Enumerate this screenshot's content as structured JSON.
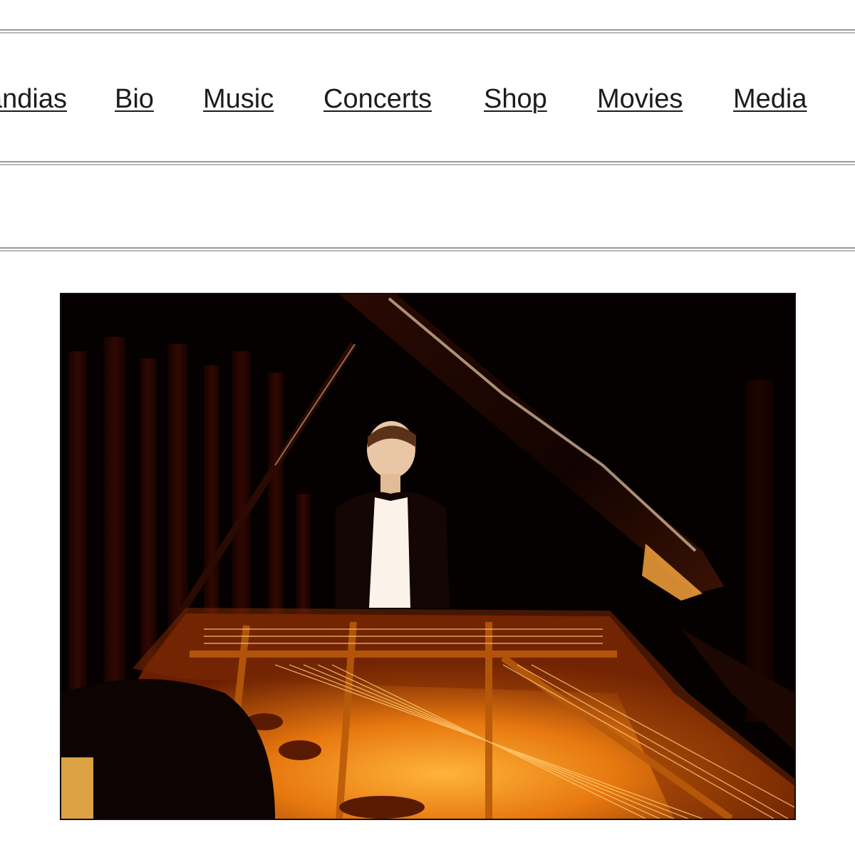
{
  "nav": {
    "items": [
      {
        "label": "Landias"
      },
      {
        "label": "Bio"
      },
      {
        "label": "Music"
      },
      {
        "label": "Concerts"
      },
      {
        "label": "Shop"
      },
      {
        "label": "Movies"
      },
      {
        "label": "Media"
      }
    ]
  },
  "photo": {
    "subject": "pianist-at-open-grand-piano"
  },
  "colors": {
    "background": "#ffffff",
    "link": "#1c1c1c",
    "rule": "#9a9a9a",
    "photo_dark": "#050100",
    "photo_gold": "#f29a1c"
  }
}
